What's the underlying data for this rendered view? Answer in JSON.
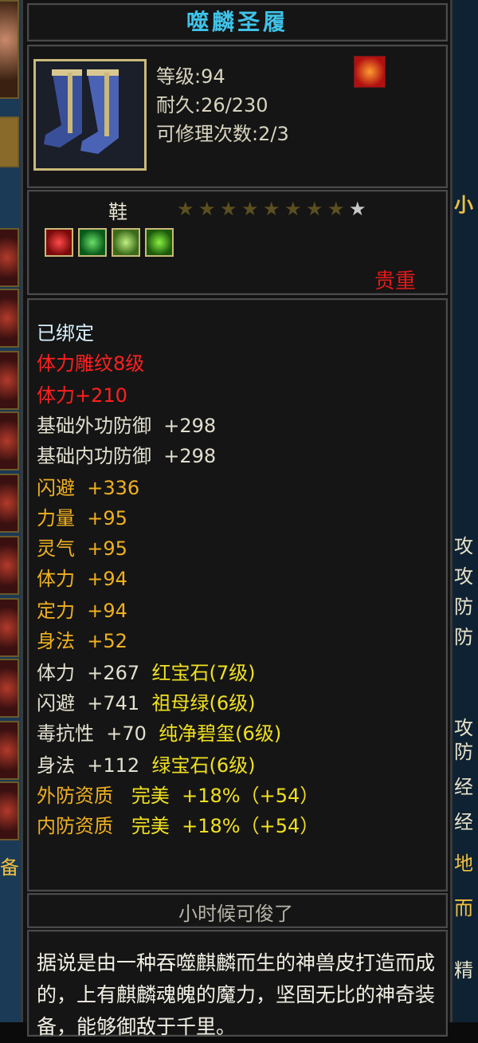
{
  "item": {
    "name": "噬麟圣履",
    "level": "等级:94",
    "durability": "耐久:26/230",
    "repair": "可修理次数:2/3",
    "type": "鞋",
    "stars_total": 9,
    "stars_filled": 8,
    "rarity": "贵重",
    "signature": "小时候可俊了",
    "description": "据说是由一种吞噬麒麟而生的神兽皮打造而成的，上有麒麟魂魄的魔力，坚固无比的神奇装备，能够御敌于千里。"
  },
  "attributes": [
    {
      "label": "已绑定",
      "value": "",
      "extra": ""
    },
    {
      "label": "体力雕纹8级",
      "value": "",
      "extra": ""
    },
    {
      "label": "体力",
      "value": "+210",
      "extra": ""
    },
    {
      "label": "基础外功防御",
      "value": "+298",
      "extra": ""
    },
    {
      "label": "基础内功防御",
      "value": "+298",
      "extra": ""
    },
    {
      "label": "闪避",
      "value": "+336",
      "extra": ""
    },
    {
      "label": "力量",
      "value": "+95",
      "extra": ""
    },
    {
      "label": "灵气",
      "value": "+95",
      "extra": ""
    },
    {
      "label": "体力",
      "value": "+94",
      "extra": ""
    },
    {
      "label": "定力",
      "value": "+94",
      "extra": ""
    },
    {
      "label": "身法",
      "value": "+52",
      "extra": ""
    },
    {
      "label": "体力",
      "value": "+267",
      "extra": "红宝石(7级)"
    },
    {
      "label": "闪避",
      "value": "+741",
      "extra": "祖母绿(6级)"
    },
    {
      "label": "毒抗性",
      "value": "+70",
      "extra": "纯净碧玺(6级)"
    },
    {
      "label": "身法",
      "value": "+112",
      "extra": "绿宝石(6级)"
    },
    {
      "label": "外防资质",
      "value": "完美",
      "extra": "+18%（+54）"
    },
    {
      "label": "内防资质",
      "value": "完美",
      "extra": "+18%（+54）"
    }
  ],
  "side_panel": {
    "right_labels": [
      "小",
      "攻",
      "攻",
      "防",
      "防",
      "攻",
      "防",
      "经",
      "经",
      "地",
      "而",
      "精"
    ],
    "left_label": "备"
  },
  "colors": {
    "title": "#3fc2e8",
    "rarity": "#e01a1a",
    "engraving": "#ff2020",
    "base_attr": "#e2dfcf",
    "gold_attr": "#f0b020",
    "gem_text": "#f0e020",
    "frame": "#c9b97a"
  }
}
